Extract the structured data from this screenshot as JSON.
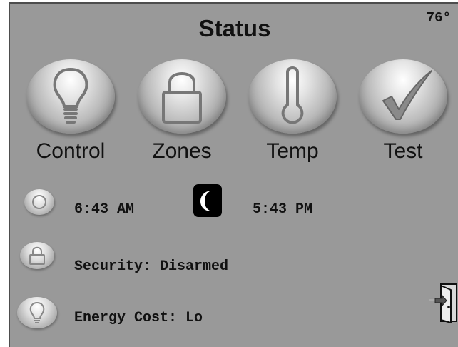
{
  "header": {
    "title": "Status",
    "temperature": "76°"
  },
  "nav": {
    "buttons": [
      {
        "label": "Control",
        "icon": "lightbulb-icon"
      },
      {
        "label": "Zones",
        "icon": "padlock-icon"
      },
      {
        "label": "Temp",
        "icon": "thermometer-icon"
      },
      {
        "label": "Test",
        "icon": "checkmark-icon"
      }
    ]
  },
  "status": {
    "sunrise": {
      "icon": "sun-icon",
      "time": "6:43 AM"
    },
    "sunset": {
      "icon": "moon-icon",
      "time": "5:43 PM"
    },
    "security": {
      "icon": "padlock-icon",
      "text": "Security: Disarmed"
    },
    "energy": {
      "icon": "lightbulb-icon",
      "text": "Energy Cost: Lo"
    }
  },
  "footer": {
    "exit_icon": "exit-door-icon"
  },
  "colors": {
    "panel_background": "#999999",
    "text": "#111111",
    "frame_border": "#4d4d4d"
  }
}
